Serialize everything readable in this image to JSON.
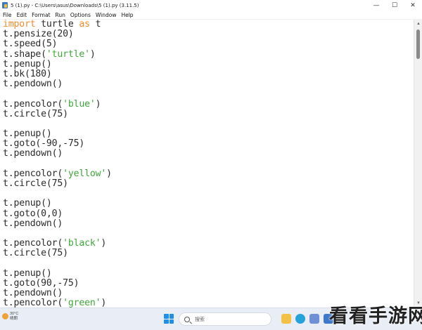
{
  "window": {
    "title": "5 (1).py - C:\\Users\\asus\\Downloads\\5 (1).py (3.11.5)",
    "minimize_glyph": "—",
    "maximize_glyph": "☐",
    "close_glyph": "✕"
  },
  "menu": {
    "items": [
      "File",
      "Edit",
      "Format",
      "Run",
      "Options",
      "Window",
      "Help"
    ]
  },
  "editor": {
    "lines": [
      [
        {
          "t": "import",
          "c": "kw"
        },
        {
          "t": " turtle ",
          "c": ""
        },
        {
          "t": "as",
          "c": "kw"
        },
        {
          "t": " t",
          "c": ""
        }
      ],
      [
        {
          "t": "t.pensize(20)",
          "c": ""
        }
      ],
      [
        {
          "t": "t.speed(5)",
          "c": ""
        }
      ],
      [
        {
          "t": "t.shape(",
          "c": ""
        },
        {
          "t": "'turtle'",
          "c": "str"
        },
        {
          "t": ")",
          "c": ""
        }
      ],
      [
        {
          "t": "t.penup()",
          "c": ""
        }
      ],
      [
        {
          "t": "t.bk(180)",
          "c": ""
        }
      ],
      [
        {
          "t": "t.pendown()",
          "c": ""
        }
      ],
      [],
      [
        {
          "t": "t.pencolor(",
          "c": ""
        },
        {
          "t": "'blue'",
          "c": "str"
        },
        {
          "t": ")",
          "c": ""
        }
      ],
      [
        {
          "t": "t.circle(75)",
          "c": ""
        }
      ],
      [],
      [
        {
          "t": "t.penup()",
          "c": ""
        }
      ],
      [
        {
          "t": "t.goto(-90,-75)",
          "c": ""
        }
      ],
      [
        {
          "t": "t.pendown()",
          "c": ""
        }
      ],
      [],
      [
        {
          "t": "t.pencolor(",
          "c": ""
        },
        {
          "t": "'yellow'",
          "c": "str"
        },
        {
          "t": ")",
          "c": ""
        }
      ],
      [
        {
          "t": "t.circle(75)",
          "c": ""
        }
      ],
      [],
      [
        {
          "t": "t.penup()",
          "c": ""
        }
      ],
      [
        {
          "t": "t.goto(0,0)",
          "c": ""
        }
      ],
      [
        {
          "t": "t.pendown()",
          "c": ""
        }
      ],
      [],
      [
        {
          "t": "t.pencolor(",
          "c": ""
        },
        {
          "t": "'black'",
          "c": "str"
        },
        {
          "t": ")",
          "c": ""
        }
      ],
      [
        {
          "t": "t.circle(75)",
          "c": ""
        }
      ],
      [],
      [
        {
          "t": "t.penup()",
          "c": ""
        }
      ],
      [
        {
          "t": "t.goto(90,-75)",
          "c": ""
        }
      ],
      [
        {
          "t": "t.pendown()",
          "c": ""
        }
      ],
      [
        {
          "t": "t.pencolor(",
          "c": ""
        },
        {
          "t": "'green'",
          "c": "str"
        },
        {
          "t": ")",
          "c": ""
        }
      ]
    ]
  },
  "colors": {
    "keyword": "#f28b2c",
    "string": "#3ea83a",
    "text": "#2b2b2b"
  },
  "scrollbar": {
    "position_fraction": 0.0
  },
  "taskbar": {
    "weather_temp": "30°C",
    "weather_desc": "晴朗",
    "search_placeholder": "搜索",
    "start_icon": "windows-start-icon",
    "pinned_icons": [
      "file-explorer-icon",
      "edge-browser-icon",
      "store-icon",
      "python-idle-icon"
    ]
  },
  "watermark": {
    "text": "看看手游网"
  }
}
